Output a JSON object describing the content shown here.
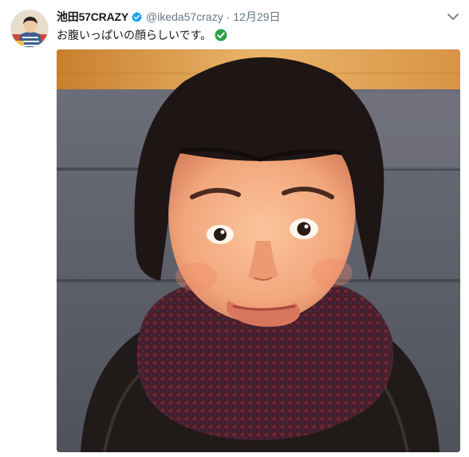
{
  "tweet": {
    "display_name": "池田57CRAZY",
    "handle": "@ikeda57crazy",
    "separator": "·",
    "timestamp": "12月29日",
    "text": "お腹いっぱいの顔らしいです。",
    "verified": true,
    "text_emoji": "check-mark-button",
    "colors": {
      "verified": "#1da1f2",
      "emoji_check": "#2ea043",
      "secondary_text": "#657786"
    }
  }
}
